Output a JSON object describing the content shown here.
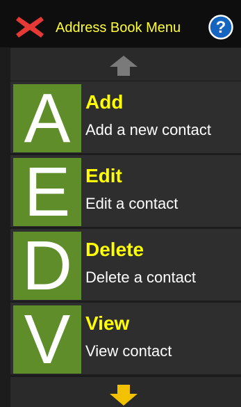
{
  "header": {
    "title": "Address Book Menu",
    "close_icon": "close-icon",
    "help_icon": "help-icon"
  },
  "navigation": {
    "up_icon": "arrow-up-icon",
    "down_icon": "arrow-down-icon",
    "up_color": "#7a7a7a",
    "down_color": "#f2c200"
  },
  "menu": {
    "items": [
      {
        "letter": "A",
        "title": "Add",
        "subtitle": "Add a new contact"
      },
      {
        "letter": "E",
        "title": "Edit",
        "subtitle": "Edit a contact"
      },
      {
        "letter": "D",
        "title": "Delete",
        "subtitle": "Delete a contact"
      },
      {
        "letter": "V",
        "title": "View",
        "subtitle": "View contact"
      }
    ]
  },
  "colors": {
    "accent_text": "#ffff00",
    "tile_green": "#5f8d2a",
    "close_red": "#e53935",
    "help_blue": "#1565c0"
  }
}
